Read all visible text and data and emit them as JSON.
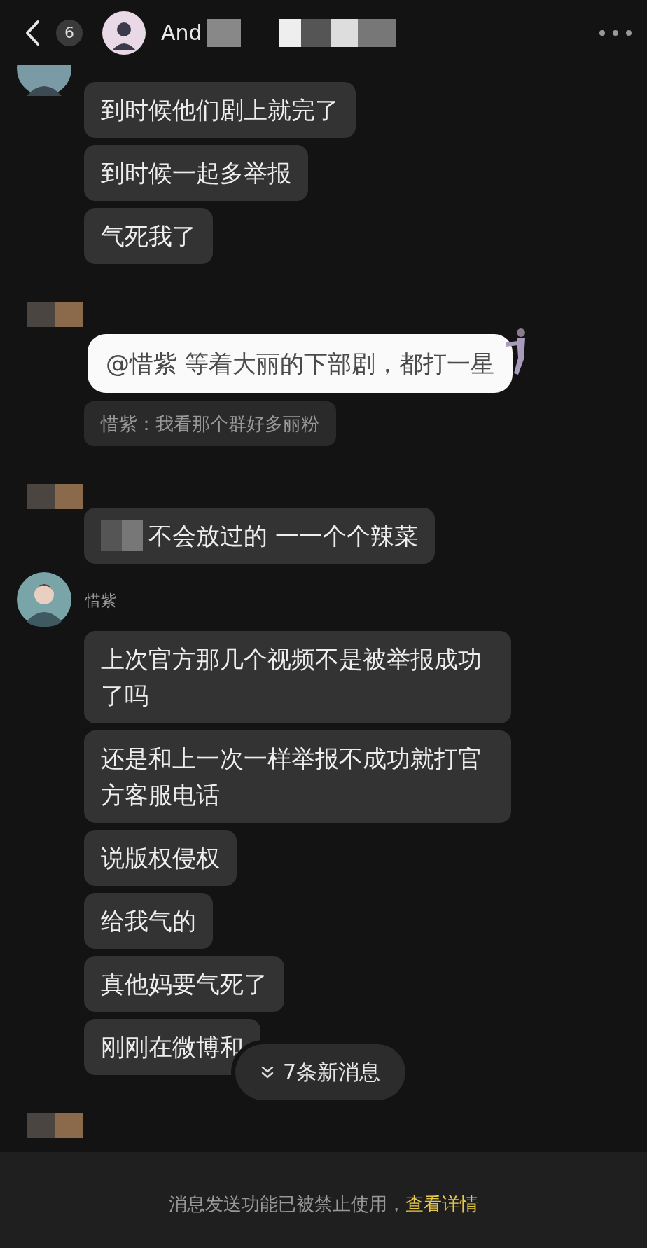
{
  "header": {
    "back_count": "6",
    "name": "And"
  },
  "items": [
    {
      "kind": "avatar_cut"
    },
    {
      "kind": "text",
      "text": "到时候他们剧上就完了"
    },
    {
      "kind": "text",
      "text": "到时候一起多举报"
    },
    {
      "kind": "text",
      "text": "气死我了"
    },
    {
      "kind": "mosaic"
    },
    {
      "kind": "sticker",
      "text": "@惜紫 等着大丽的下部剧，都打一星"
    },
    {
      "kind": "quote",
      "text": "惜紫：我看那个群好多丽粉"
    },
    {
      "kind": "mosaic"
    },
    {
      "kind": "text_blurred",
      "text": "不会放过的 一一个个辣菜"
    },
    {
      "kind": "sender",
      "name": "惜紫"
    },
    {
      "kind": "text",
      "text": "上次官方那几个视频不是被举报成功了吗"
    },
    {
      "kind": "text",
      "text": "还是和上一次一样举报不成功就打官方客服电话"
    },
    {
      "kind": "text",
      "text": "说版权侵权"
    },
    {
      "kind": "text",
      "text": "给我气的"
    },
    {
      "kind": "text",
      "text": "真他妈要气死了"
    },
    {
      "kind": "text",
      "text": "刚刚在微博和"
    },
    {
      "kind": "mosaic"
    }
  ],
  "new_messages": "7条新消息",
  "footer": {
    "notice": "消息发送功能已被禁止使用，",
    "link": "查看详情"
  }
}
